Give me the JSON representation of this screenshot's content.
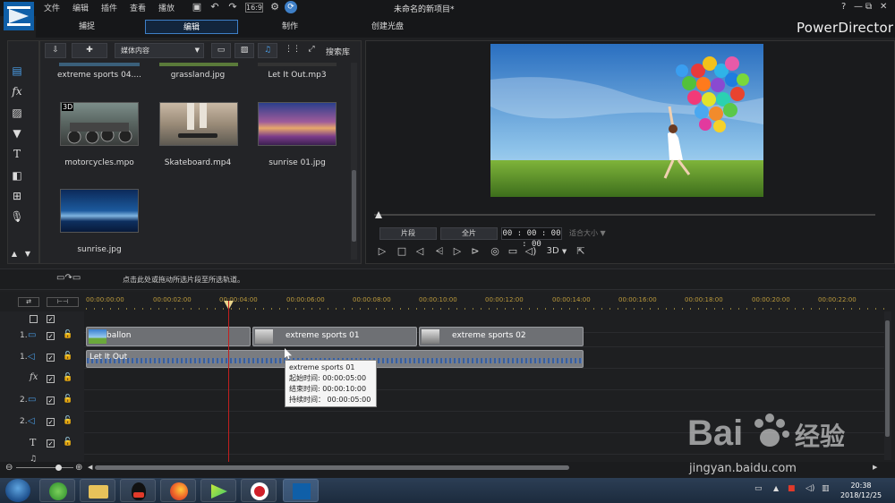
{
  "window": {
    "title": "未命名的新项目*",
    "app_name": "PowerDirector",
    "controls": [
      "?",
      "—",
      "⧉",
      "✕"
    ]
  },
  "menu": [
    "文件",
    "编辑",
    "插件",
    "查看",
    "播放"
  ],
  "modes": [
    "捕捉",
    "编辑",
    "制作",
    "创建光盘"
  ],
  "library": {
    "media_dropdown": "媒体内容",
    "search_label": "搜索库",
    "items": [
      {
        "name": "extreme sports 04....",
        "truncated": true
      },
      {
        "name": "grassland.jpg",
        "truncated": true
      },
      {
        "name": "Let It Out.mp3",
        "truncated": true
      },
      {
        "name": "motorcycles.mpo",
        "badge": "3D"
      },
      {
        "name": "Skateboard.mp4"
      },
      {
        "name": "sunrise 01.jpg"
      },
      {
        "name": "sunrise.jpg"
      }
    ]
  },
  "preview": {
    "btn_clip": "片段",
    "btn_movie": "全片",
    "timecode": "00 : 00 : 00 : 00",
    "fit_size": "适合大小",
    "mode_3d": "3D"
  },
  "timeline": {
    "drag_hint": "点击此处或拖动所选片段至所选轨道。",
    "ruler": [
      "00:00:00:00",
      "00:00:02:00",
      "00:00:04:00",
      "00:00:06:00",
      "00:00:08:00",
      "00:00:10:00",
      "00:00:12:00",
      "00:00:14:00",
      "00:00:16:00",
      "00:00:18:00",
      "00:00:20:00",
      "00:00:22:00"
    ],
    "tracks": [
      {
        "label": "",
        "kind": "master"
      },
      {
        "label": "1.",
        "kind": "video"
      },
      {
        "label": "1.",
        "kind": "audio"
      },
      {
        "label": "",
        "kind": "fx"
      },
      {
        "label": "2.",
        "kind": "video"
      },
      {
        "label": "2.",
        "kind": "audio"
      },
      {
        "label": "",
        "kind": "title"
      },
      {
        "label": "",
        "kind": "voice"
      }
    ],
    "video_clips": [
      "ballon",
      "extreme sports 01",
      "extreme sports 02"
    ],
    "audio_clip": "Let It Out",
    "tooltip": {
      "title": "extreme sports 01",
      "start": "起始时间:  00:00:05:00",
      "end": "结束时间:  00:00:10:00",
      "duration": "持续时间：  00:00:05:00"
    }
  },
  "taskbar": {
    "time": "20:38",
    "date": "2018/12/25"
  },
  "watermark": {
    "line1": "Bai",
    "line2": "经验",
    "url": "jingyan.baidu.com"
  },
  "colors": {
    "accent": "#3e7fc7",
    "playhead": "#c21f1f",
    "ruler_text": "#bb9a3c",
    "video_track_icon": "#4a9ee8"
  }
}
